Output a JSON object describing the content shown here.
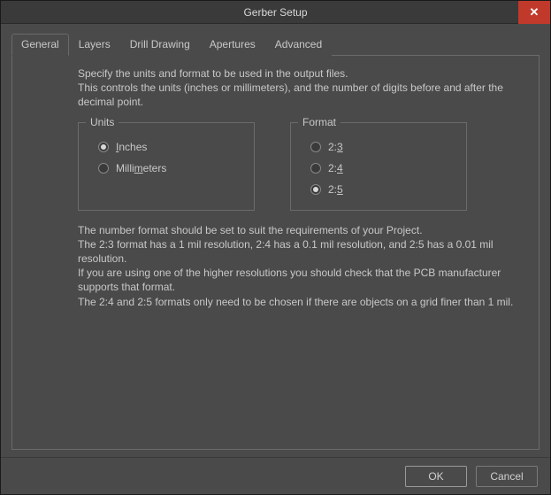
{
  "dialog": {
    "title": "Gerber Setup",
    "close_glyph": "✕"
  },
  "tabs": {
    "general": "General",
    "layers": "Layers",
    "drill": "Drill Drawing",
    "apertures": "Apertures",
    "advanced": "Advanced",
    "active": "general"
  },
  "general": {
    "desc_line1": "Specify the units and format to be used in the output files.",
    "desc_line2": "This controls the units (inches or millimeters), and the number of digits before and after the decimal point.",
    "units": {
      "title": "Units",
      "inches": {
        "label_pre": "",
        "label_u": "I",
        "label_post": "nches",
        "checked": true
      },
      "mm": {
        "label_pre": "Milli",
        "label_u": "m",
        "label_post": "eters",
        "checked": false
      }
    },
    "format": {
      "title": "Format",
      "f23": {
        "label_pre": "2:",
        "label_u": "3",
        "label_post": "",
        "checked": false
      },
      "f24": {
        "label_pre": "2:",
        "label_u": "4",
        "label_post": "",
        "checked": false
      },
      "f25": {
        "label_pre": "2:",
        "label_u": "5",
        "label_post": "",
        "checked": true
      }
    },
    "note_line1": "The number format should be set to suit the requirements of your Project.",
    "note_line2": "The 2:3 format has a 1 mil resolution, 2:4 has a 0.1 mil resolution, and 2:5 has a 0.01 mil resolution.",
    "note_line3": "If you are using one of the higher resolutions you should check that the PCB manufacturer supports that format.",
    "note_line4": "The 2:4 and 2:5 formats only need to be chosen if there are objects on a grid finer than 1 mil."
  },
  "buttons": {
    "ok": "OK",
    "cancel": "Cancel"
  }
}
